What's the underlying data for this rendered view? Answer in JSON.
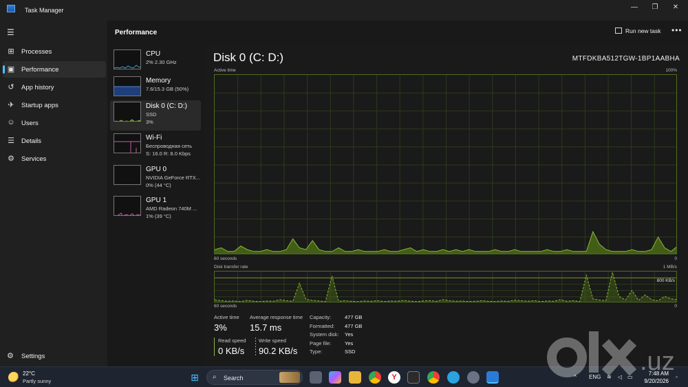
{
  "window": {
    "title": "Task Manager"
  },
  "nav": {
    "items": [
      {
        "label": "Processes",
        "icon": "processes-icon",
        "glyph": "⊞"
      },
      {
        "label": "Performance",
        "icon": "performance-icon",
        "glyph": "▣",
        "active": true
      },
      {
        "label": "App history",
        "icon": "history-icon",
        "glyph": "↺"
      },
      {
        "label": "Startup apps",
        "icon": "startup-icon",
        "glyph": "✈"
      },
      {
        "label": "Users",
        "icon": "users-icon",
        "glyph": "☺"
      },
      {
        "label": "Details",
        "icon": "details-icon",
        "glyph": "☰"
      },
      {
        "label": "Services",
        "icon": "services-icon",
        "glyph": "⚙"
      }
    ],
    "settings_label": "Settings"
  },
  "header": {
    "title": "Performance",
    "run_task_label": "Run new task"
  },
  "resources": [
    {
      "name": "CPU",
      "sub1": "2% 2.30 GHz",
      "sub2": ""
    },
    {
      "name": "Memory",
      "sub1": "7.6/15.3 GB (50%)",
      "sub2": ""
    },
    {
      "name": "Disk 0 (C: D:)",
      "sub1": "SSD",
      "sub2": "3%",
      "active": true
    },
    {
      "name": "Wi-Fi",
      "sub1": "Беспроводная сеть",
      "sub2": "S: 16.0  R: 8.0 Kbps"
    },
    {
      "name": "GPU 0",
      "sub1": "NVIDIA GeForce RTX...",
      "sub2": "0% (44 °C)"
    },
    {
      "name": "GPU 1",
      "sub1": "AMD Radeon 740M ...",
      "sub2": "1% (39 °C)"
    }
  ],
  "detail": {
    "title": "Disk 0 (C: D:)",
    "model": "MTFDKBA512TGW-1BP1AABHA",
    "active_time_label": "Active time",
    "active_time_max": "100%",
    "active_time_left": "60 seconds",
    "active_time_right": "0",
    "transfer_label": "Disk transfer rate",
    "transfer_max": "1 MB/s",
    "transfer_mid": "800 KB/s",
    "transfer_left": "60 seconds",
    "transfer_right": "0"
  },
  "stats": {
    "active_time": {
      "label": "Active time",
      "value": "3%"
    },
    "avg_response": {
      "label": "Average response time",
      "value": "15.7 ms"
    },
    "read_speed": {
      "label": "Read speed",
      "value": "0 KB/s"
    },
    "write_speed": {
      "label": "Write speed",
      "value": "90.2 KB/s"
    }
  },
  "properties": [
    {
      "key": "Capacity:",
      "value": "477 GB"
    },
    {
      "key": "Formatted:",
      "value": "477 GB"
    },
    {
      "key": "System disk:",
      "value": "Yes"
    },
    {
      "key": "Page file:",
      "value": "Yes"
    },
    {
      "key": "Type:",
      "value": "SSD"
    }
  ],
  "colors": {
    "accent": "#4cc2ff",
    "disk_line": "#8bb83a",
    "disk_fill": "#4a6b16",
    "cpu_line": "#3aa0e0",
    "memory_fill": "#1f3f7a",
    "wifi_line": "#c25aa8"
  },
  "chart_data": [
    {
      "type": "area",
      "title": "Active time",
      "x_range": [
        60,
        0
      ],
      "ylim": [
        0,
        100
      ],
      "unit": "%",
      "values": [
        3,
        4,
        2,
        2,
        5,
        3,
        2,
        2,
        3,
        2,
        2,
        3,
        9,
        4,
        3,
        8,
        3,
        2,
        2,
        4,
        2,
        2,
        3,
        2,
        2,
        2,
        3,
        2,
        2,
        3,
        4,
        2,
        3,
        2,
        2,
        3,
        2,
        3,
        2,
        3,
        2,
        2,
        2,
        3,
        2,
        2,
        3,
        2,
        2,
        2,
        2,
        3,
        2,
        2,
        3,
        2,
        2,
        2,
        13,
        6,
        3,
        2,
        2,
        2,
        3,
        2,
        2,
        3,
        10,
        4,
        2,
        5
      ]
    },
    {
      "type": "line",
      "title": "Disk transfer rate",
      "x_range": [
        60,
        0
      ],
      "ylim": [
        0,
        1000
      ],
      "unit": "KB/s",
      "series": [
        {
          "name": "Read speed",
          "values": [
            0,
            0,
            0,
            0,
            0,
            0,
            0,
            0,
            0,
            0,
            0,
            0,
            0,
            0,
            0,
            0,
            0,
            0,
            0,
            0,
            0,
            0,
            0,
            0,
            0,
            0,
            0,
            0,
            0,
            0,
            0,
            0,
            0,
            0,
            0,
            0,
            0,
            0,
            0,
            0,
            0,
            0,
            0,
            0,
            0,
            0,
            0,
            0,
            0,
            0,
            0,
            0,
            0,
            0,
            0,
            0,
            0,
            0,
            0,
            0,
            0,
            0,
            0,
            0,
            0,
            0,
            0,
            0,
            0,
            0,
            0,
            0
          ]
        },
        {
          "name": "Write speed",
          "values": [
            90,
            60,
            40,
            50,
            30,
            70,
            40,
            30,
            50,
            40,
            90,
            60,
            40,
            640,
            100,
            70,
            50,
            30,
            880,
            40,
            60,
            40,
            30,
            50,
            40,
            60,
            30,
            50,
            40,
            70,
            40,
            30,
            50,
            60,
            40,
            90,
            60,
            40,
            50,
            30,
            40,
            60,
            40,
            30,
            50,
            40,
            70,
            60,
            40,
            60,
            30,
            50,
            40,
            90,
            40,
            60,
            30,
            900,
            120,
            80,
            60,
            1000,
            200,
            80,
            400,
            70,
            250,
            90,
            60,
            200,
            120,
            90
          ]
        }
      ]
    }
  ]
}
